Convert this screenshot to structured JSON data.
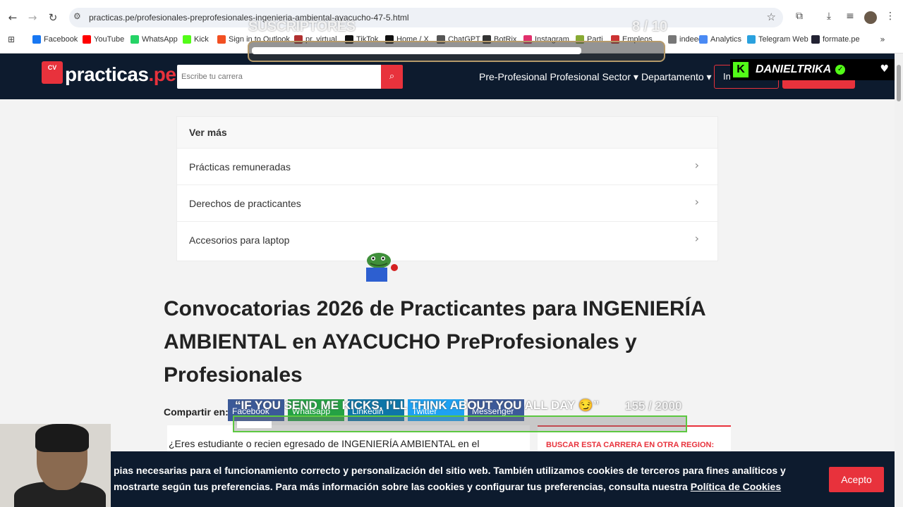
{
  "browser": {
    "url": "practicas.pe/profesionales-preprofesionales-ingenieria-ambiental-ayacucho-47-5.html",
    "bookmarks": [
      "Facebook",
      "YouTube",
      "WhatsApp",
      "Kick",
      "Sign in to Outlook",
      "pr. virtual",
      "TikTok",
      "Home / X",
      "ChatGPT",
      "BotRix",
      "Instagram",
      "Parti",
      "Empleos",
      "indeed",
      "Analytics",
      "Telegram Web",
      "formate.pe"
    ]
  },
  "site": {
    "logo_badge": "CV",
    "logo_main": "practicas",
    "logo_suffix": ".pe",
    "search_placeholder": "Escribe tu carrera",
    "nav": [
      "Pre-Profesional",
      "Profesional",
      "Sector",
      "Departamento"
    ],
    "login_label": "In"
  },
  "overlay": {
    "goal_title": "SUSCRIPTORES",
    "goal_count": "8 / 10",
    "goal_progress": 0.8,
    "streamer": "DANIELTRIKA",
    "kick_message": "“IF YOU SEND ME KICKS, I’LL THINK ABOUT YOU ALL DAY 😏”",
    "kick_count": "155 / 2000",
    "kick_progress": 0.0775
  },
  "card": {
    "heading": "Ver más",
    "items": [
      "Prácticas remuneradas",
      "Derechos de practicantes",
      "Accesorios para laptop"
    ]
  },
  "main": {
    "title": "Convocatorias 2026 de Practicantes para INGENIERÍA AMBIENTAL en AYACUCHO PreProfesionales y Profesionales",
    "share_label": "Compartir en:",
    "share_buttons": [
      "Facebook",
      "Whatsapp",
      "Linkedin",
      "Twitter",
      "Messenger"
    ],
    "intro": "¿Eres estudiante o recien egresado de INGENIERÍA AMBIENTAL en el",
    "side_heading": "BUSCAR ESTA CARRERA EN OTRA REGION:"
  },
  "cookie": {
    "text": "pias necesarias para el funcionamiento correcto y personalización del sitio web. También utilizamos cookies de terceros para fines analíticos y mostrarte según tus preferencias. Para más información sobre las cookies y configurar tus preferencias, consulta nuestra ",
    "link": "Política de Cookies",
    "accept": "Acepto"
  },
  "colors": {
    "brand_red": "#e8323c",
    "header_navy": "#0d1b2e",
    "kick_green": "#53fc18"
  }
}
